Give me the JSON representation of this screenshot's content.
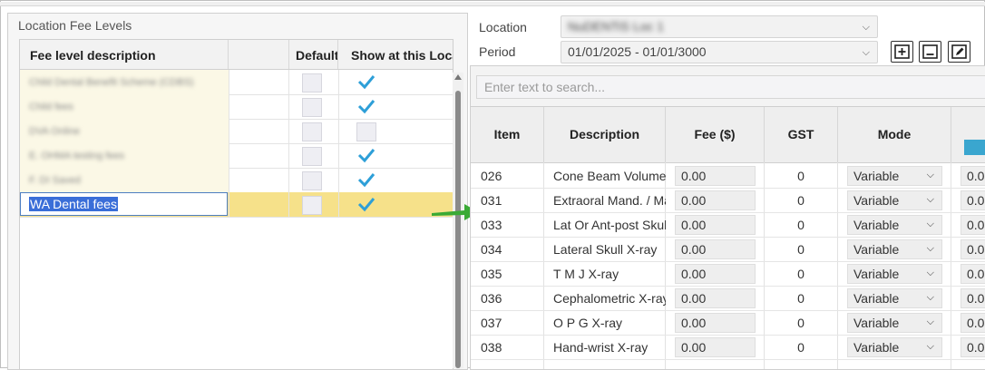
{
  "left": {
    "title": "Location Fee Levels",
    "headers": [
      "Fee level description",
      "",
      "Default",
      "Show at this Location"
    ],
    "rows": [
      {
        "desc": "Child Dental Benefit Scheme (CDBS)",
        "show": true
      },
      {
        "desc": "Child fees",
        "show": true
      },
      {
        "desc": "DVA Online",
        "show": false
      },
      {
        "desc": "E. OHMA testing fees",
        "show": true
      },
      {
        "desc": "F. DI Saved",
        "show": true
      }
    ],
    "selected_row": {
      "desc": "WA Dental fees",
      "show": true
    }
  },
  "right": {
    "location_label": "Location",
    "location_value": "NuDENTiS Loc 1",
    "period_label": "Period",
    "period_value": "01/01/2025 - 01/01/3000",
    "search_placeholder": "Enter text to search...",
    "columns": [
      "Item",
      "Description",
      "Fee ($)",
      "GST",
      "Mode"
    ],
    "rows": [
      {
        "item": "026",
        "desc": "Cone Beam Volumetric",
        "fee": "0.00",
        "gst": "0",
        "mode": "Variable",
        "extra": "0.0"
      },
      {
        "item": "031",
        "desc": "Extraoral Mand. / Max.",
        "fee": "0.00",
        "gst": "0",
        "mode": "Variable",
        "extra": "0.0"
      },
      {
        "item": "033",
        "desc": "Lat Or Ant-post Skull",
        "fee": "0.00",
        "gst": "0",
        "mode": "Variable",
        "extra": "0.0"
      },
      {
        "item": "034",
        "desc": "Lateral Skull X-ray",
        "fee": "0.00",
        "gst": "0",
        "mode": "Variable",
        "extra": "0.0"
      },
      {
        "item": "035",
        "desc": "T M J X-ray",
        "fee": "0.00",
        "gst": "0",
        "mode": "Variable",
        "extra": "0.0"
      },
      {
        "item": "036",
        "desc": "Cephalometric X-ray",
        "fee": "0.00",
        "gst": "0",
        "mode": "Variable",
        "extra": "0.0"
      },
      {
        "item": "037",
        "desc": "O P G X-ray",
        "fee": "0.00",
        "gst": "0",
        "mode": "Variable",
        "extra": "0.0"
      },
      {
        "item": "038",
        "desc": "Hand-wrist X-ray",
        "fee": "0.00",
        "gst": "0",
        "mode": "Variable",
        "extra": "0.0"
      }
    ]
  },
  "colors": {
    "accent": "#3aa6cf",
    "selection": "#f6e18a",
    "arrow": "#3aaa35",
    "tick": "#2d9fd8"
  }
}
